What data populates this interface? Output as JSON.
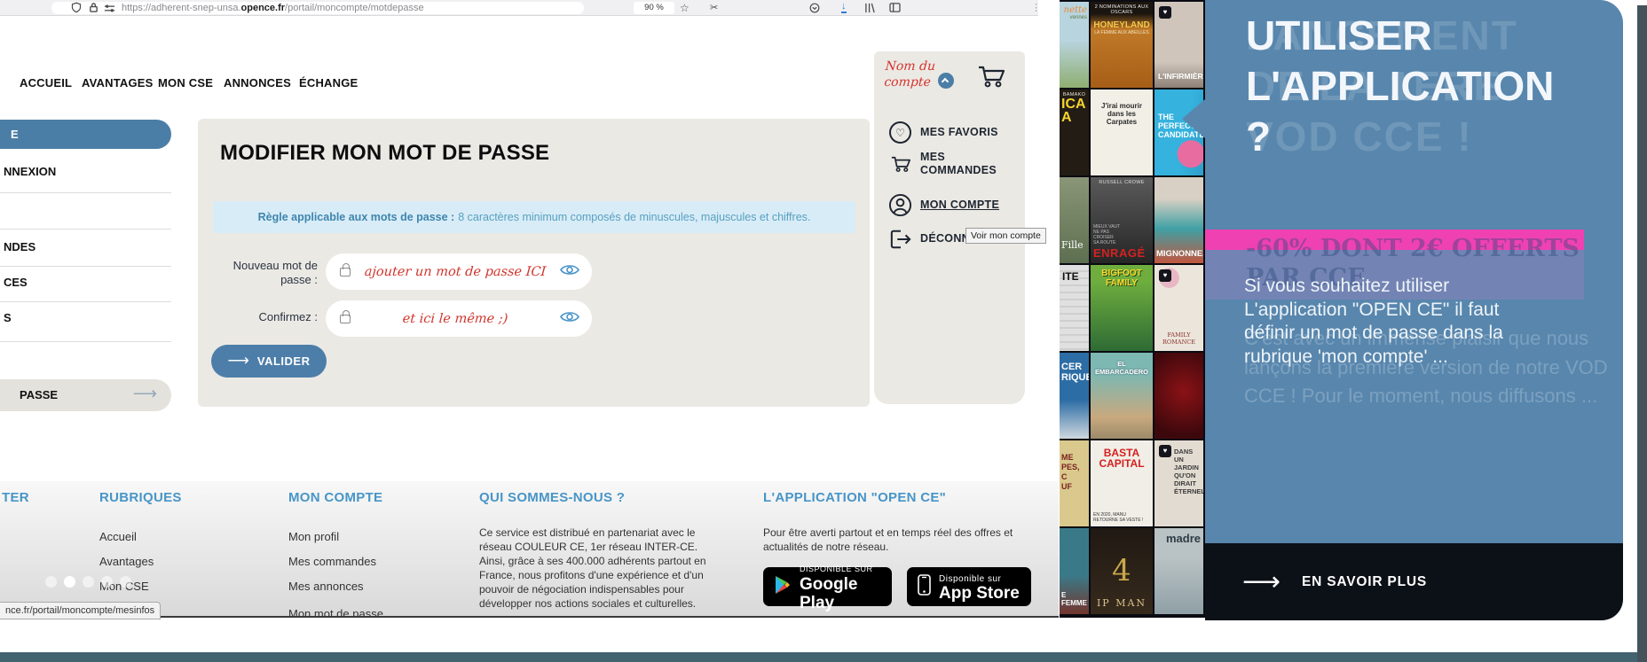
{
  "colors": {
    "accent_blue": "#4b7ea7",
    "panel_blue": "#5886ad",
    "pink": "#ef41b2",
    "footer_header_blue": "#4795c7",
    "annotation_red": "#d0342c",
    "rule_box_bg": "#d8ecf7",
    "card_bg": "#ebe9e4",
    "teal_bar": "#42636f",
    "cta_dark": "#0c1117",
    "download_icon_blue": "#2e7fd2"
  },
  "browser": {
    "url_1": "https://adherent-snep-unsa.",
    "url_2": "opence.fr",
    "url_3": "/portail/moncompte/motdepasse",
    "zoom": "90 %"
  },
  "nav": {
    "items": [
      "ACCUEIL",
      "AVANTAGES",
      "MON CSE",
      "ANNONCES",
      "ÉCHANGE"
    ]
  },
  "account": {
    "name_line1": "Nom du",
    "name_line2": "compte",
    "menu": [
      {
        "label": "MES FAVORIS"
      },
      {
        "label": "MES COMMANDES"
      },
      {
        "label": "MON COMPTE"
      },
      {
        "label": "DÉCONNEXION"
      }
    ],
    "tooltip": "Voir mon compte"
  },
  "sidebar": {
    "active_fragment": "E",
    "item1": "NNEXION",
    "item2": "",
    "item3": "NDES",
    "item4": "CES",
    "item5": "S",
    "bottom_fragment": "PASSE"
  },
  "form": {
    "title": "MODIFIER MON MOT DE PASSE",
    "rule_label": "Règle applicable aux mots de passe :",
    "rule_text": "8 caractères minimum composés de minuscules, majuscules et chiffres.",
    "new_password_label": "Nouveau mot de passe :",
    "new_password_annotation": "ajouter un mot de passe ICI",
    "confirm_label": "Confirmez :",
    "confirm_annotation": "et ici le même ;)",
    "submit": "VALIDER"
  },
  "footer": {
    "contact_header_fragment": "TER",
    "rubriques": {
      "header": "RUBRIQUES",
      "items": [
        "Accueil",
        "Avantages",
        "Mon CSE"
      ]
    },
    "mon_compte": {
      "header": "MON COMPTE",
      "items": [
        "Mon profil",
        "Mes commandes",
        "Mes annonces",
        "Mon mot de passe"
      ]
    },
    "qui": {
      "header": "QUI SOMMES-NOUS ?",
      "body": "Ce service est distribué en partenariat avec le réseau COULEUR CE, 1er réseau INTER-CE. Ainsi, grâce à ses 400.000 adhérents partout en France, nous profitons d'une expérience et d'un pouvoir de négociation indispensables pour développer nos actions sociales et culturelles."
    },
    "app": {
      "header": "L'APPLICATION \"OPEN CE\"",
      "body": "Pour être averti partout et en temps réel des offres et actualités de notre réseau.",
      "google_line1": "DISPONIBLE SUR",
      "google_line2": "Google Play",
      "apple_line1": "Disponible sur",
      "apple_line2": "App Store"
    }
  },
  "status_bar": {
    "link": "nce.fr/portail/moncompte/mesinfos"
  },
  "promo": {
    "ghost_title": "LANCEMENT\nDE LA 1ERE\nVOD CCE !",
    "title": "UTILISER\nL'APPLICATION\n?",
    "ghost_offer": "-60% DONT 2€ OFFERTS\nPAR CCE",
    "body": "Si vous souhaitez utiliser L'application \"OPEN CE\" il faut définir un mot de passe dans la rubrique 'mon compte' ...",
    "ghost_body": "C'est avec un immense plaisir que nous lançons la première version de notre VOD CCE ! Pour le moment, nous diffusons ...",
    "cta": "EN SAVOIR PLUS"
  },
  "posters": [
    {
      "banner": "",
      "title": "nette",
      "sub": "vennes"
    },
    {
      "banner": "2 NOMINATIONS AUX OSCARS",
      "title": "HONEYLAND",
      "sub": "LA FEMME AUX ABEILLES"
    },
    {
      "banner": "",
      "title": "L'INFIRMIÈRE",
      "sub": ""
    },
    {
      "banner": "BAMAKO",
      "title": "ICA\nA",
      "sub": ""
    },
    {
      "banner": "",
      "title": "J'irai mourir dans les Carpates",
      "sub": ""
    },
    {
      "banner": "",
      "title": "THE PERFECT\nCANDIDATE",
      "sub": ""
    },
    {
      "banner": "",
      "title": "Fille",
      "sub": ""
    },
    {
      "banner": "RUSSELL CROWE",
      "title": "ENRAGÉ",
      "sub": "MIEUX VAUT\nNE PAS\nCROISER\nSA ROUTE"
    },
    {
      "banner": "",
      "title": "MIGNONNES",
      "sub": ""
    },
    {
      "banner": "",
      "title": "ITE",
      "sub": ""
    },
    {
      "banner": "",
      "title": "BIGFOOT\nFAMILY",
      "sub": ""
    },
    {
      "banner": "",
      "title": "FAMILY ROMANCE",
      "sub": ""
    },
    {
      "banner": "",
      "title": "CER\nRIQUE",
      "sub": ""
    },
    {
      "banner": "",
      "title": "EL EMBARCADERO",
      "sub": ""
    },
    {
      "banner": "",
      "title": "",
      "sub": ""
    },
    {
      "banner": "",
      "title": "ME\nPES,\nC\nUF",
      "sub": ""
    },
    {
      "banner": "",
      "title": "BASTA\nCAPITAL",
      "sub": "EN 2020, MANU\nRETOURNE SA VESTE !"
    },
    {
      "banner": "",
      "title": "DANS UN JARDIN\nQU'ON DIRAIT ÉTERNEL",
      "sub": ""
    },
    {
      "banner": "",
      "title": "E FEMME",
      "sub": ""
    },
    {
      "banner": "",
      "title": "IP MAN",
      "sub": "4"
    },
    {
      "banner": "",
      "title": "madre",
      "sub": ""
    }
  ]
}
